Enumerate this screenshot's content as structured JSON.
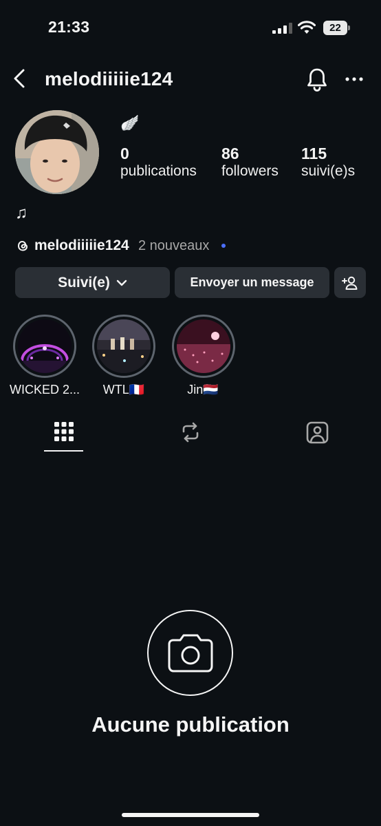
{
  "status_bar": {
    "time": "21:33",
    "battery": "22"
  },
  "header": {
    "username": "melodiiiiie124"
  },
  "profile": {
    "bio_emoji": "🪽",
    "stats": [
      {
        "value": "0",
        "label": "publications"
      },
      {
        "value": "86",
        "label": "followers"
      },
      {
        "value": "115",
        "label": "suivi(e)s"
      }
    ],
    "bio_line": "♫",
    "threads": {
      "username": "melodiiiiie124",
      "new_label": "2 nouveaux"
    }
  },
  "actions": {
    "follow_label": "Suivi(e)",
    "message_label": "Envoyer un message"
  },
  "highlights": [
    {
      "label": "WICKED 2..."
    },
    {
      "label": "WTL🇫🇷"
    },
    {
      "label": "Jin🇳🇱"
    }
  ],
  "tabs": [
    "grid",
    "reposts",
    "tagged"
  ],
  "empty_state": {
    "title": "Aucune publication"
  },
  "colors": {
    "background": "#0c1014",
    "button": "#2a2f35",
    "accent_dot": "#4c6fff"
  }
}
